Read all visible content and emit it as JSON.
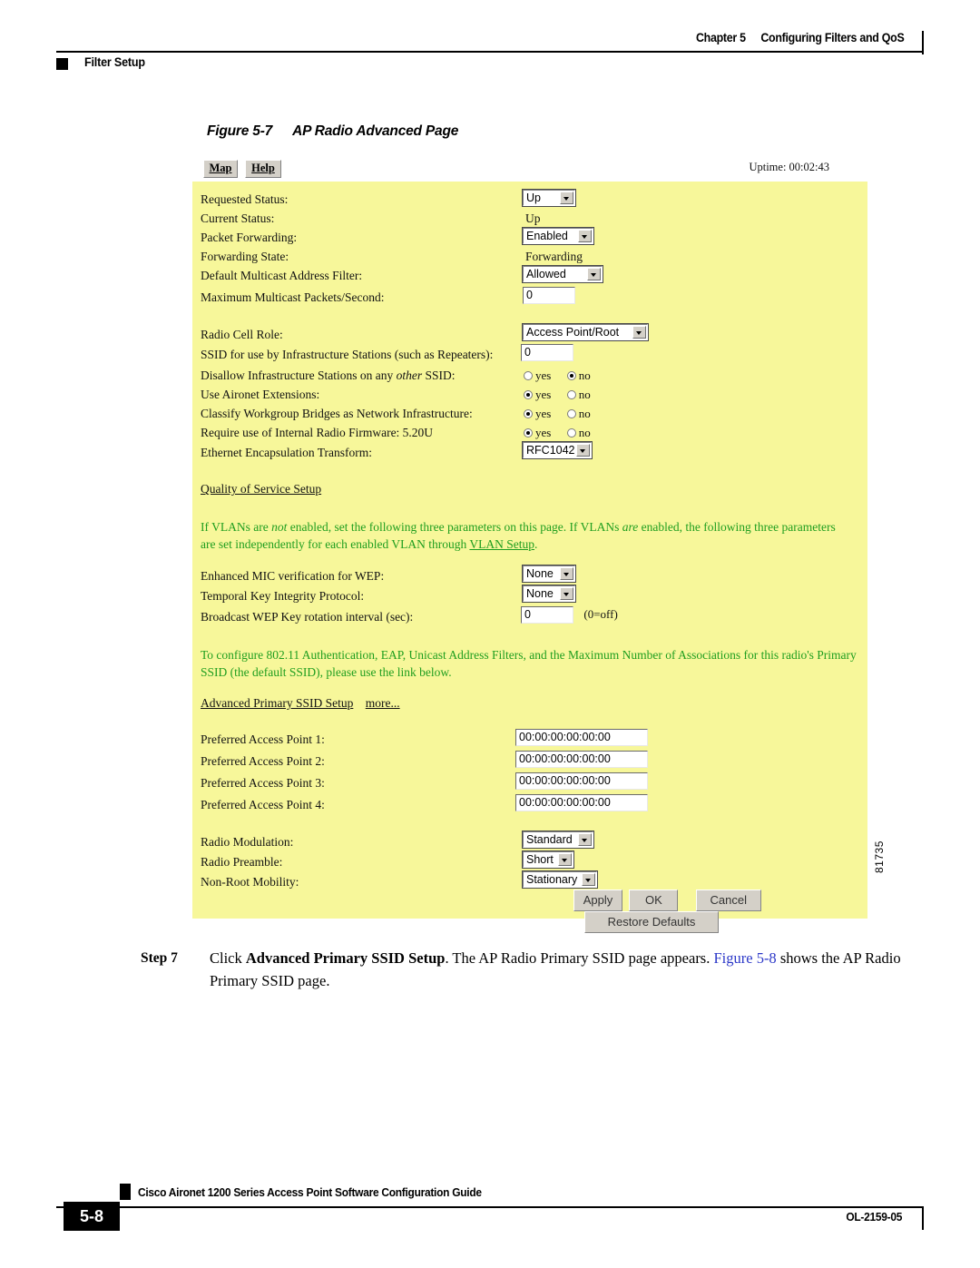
{
  "header": {
    "chapter_num": "Chapter 5",
    "chapter_title": "Configuring Filters and QoS",
    "section": "Filter Setup"
  },
  "figure": {
    "number": "Figure 5-7",
    "title": "AP Radio Advanced Page",
    "figure_id": "81735"
  },
  "screenshot": {
    "toolbar": {
      "map_label": "Map",
      "help_label": "Help",
      "uptime": "Uptime: 00:02:43"
    },
    "fields": {
      "requested_status": {
        "label": "Requested Status:",
        "value": "Up"
      },
      "current_status": {
        "label": "Current Status:",
        "value": "Up"
      },
      "packet_forwarding": {
        "label": "Packet Forwarding:",
        "value": "Enabled"
      },
      "forwarding_state": {
        "label": "Forwarding State:",
        "value": "Forwarding"
      },
      "default_multicast_filter": {
        "label": "Default Multicast Address Filter:",
        "value": "Allowed"
      },
      "max_multicast": {
        "label": "Maximum Multicast Packets/Second:",
        "value": "0"
      },
      "radio_cell_role": {
        "label": "Radio Cell Role:",
        "value": "Access Point/Root"
      },
      "ssid_infrastructure": {
        "label": "SSID for use by Infrastructure Stations (such as Repeaters):",
        "value": "0"
      },
      "disallow_infrastructure": {
        "label_part1": "Disallow Infrastructure Stations on any ",
        "label_italic": "other",
        "label_part2": " SSID:",
        "yes_label": "yes",
        "no_label": "no",
        "selected": "no"
      },
      "aironet_extensions": {
        "label": "Use Aironet Extensions:",
        "yes_label": "yes",
        "no_label": "no",
        "selected": "yes"
      },
      "classify_wgb": {
        "label": "Classify Workgroup Bridges as Network Infrastructure:",
        "yes_label": "yes",
        "no_label": "no",
        "selected": "yes"
      },
      "internal_firmware": {
        "label": "Require use of Internal Radio Firmware: 5.20U",
        "yes_label": "yes",
        "no_label": "no",
        "selected": "yes"
      },
      "ethernet_encapsulation": {
        "label": "Ethernet Encapsulation Transform:",
        "value": "RFC1042"
      },
      "enhanced_mic": {
        "label": "Enhanced MIC verification for WEP:",
        "value": "None"
      },
      "tkip": {
        "label": "Temporal Key Integrity Protocol:",
        "value": "None"
      },
      "wep_rotation": {
        "label": "Broadcast WEP Key rotation interval (sec):",
        "value": "0",
        "note": "(0=off)"
      },
      "pap1": {
        "label": "Preferred Access Point 1:",
        "value": "00:00:00:00:00:00"
      },
      "pap2": {
        "label": "Preferred Access Point 2:",
        "value": "00:00:00:00:00:00"
      },
      "pap3": {
        "label": "Preferred Access Point 3:",
        "value": "00:00:00:00:00:00"
      },
      "pap4": {
        "label": "Preferred Access Point 4:",
        "value": "00:00:00:00:00:00"
      },
      "radio_modulation": {
        "label": "Radio Modulation:",
        "value": "Standard"
      },
      "radio_preamble": {
        "label": "Radio Preamble:",
        "value": "Short"
      },
      "non_root_mobility": {
        "label": "Non-Root Mobility:",
        "value": "Stationary"
      }
    },
    "links": {
      "qos_setup": "Quality of Service Setup",
      "vlan_setup": "VLAN Setup",
      "advanced_primary_ssid": "Advanced Primary SSID Setup",
      "more": "more..."
    },
    "notes": {
      "vlan_note_a": "If VLANs are ",
      "vlan_note_italic1": "not",
      "vlan_note_b": " enabled, set the following three parameters on this page. If VLANs ",
      "vlan_note_italic2": "are",
      "vlan_note_c": " enabled, the following three parameters are set independently for each enabled VLAN through ",
      "vlan_note_d": ".",
      "ssid_note": "To configure 802.11 Authentication, EAP, Unicast Address Filters, and the Maximum Number of Associations for this radio's Primary SSID (the default SSID), please use the link below."
    },
    "buttons": {
      "apply": "Apply",
      "ok": "OK",
      "cancel": "Cancel",
      "restore_defaults": "Restore Defaults"
    },
    "colors": {
      "panel_background": "#f7f79a",
      "note_text": "#1f9e1f",
      "button_face": "#d4d0c8"
    }
  },
  "step": {
    "label": "Step 7",
    "text_a": "Click ",
    "bold": "Advanced Primary SSID Setup",
    "text_b": ". The AP Radio Primary SSID page appears. ",
    "xref": "Figure 5-8",
    "text_c": " shows the AP Radio Primary SSID page."
  },
  "footer": {
    "page_number": "5-8",
    "guide_title": "Cisco Aironet 1200 Series Access Point Software Configuration Guide",
    "doc_id": "OL-2159-05"
  }
}
